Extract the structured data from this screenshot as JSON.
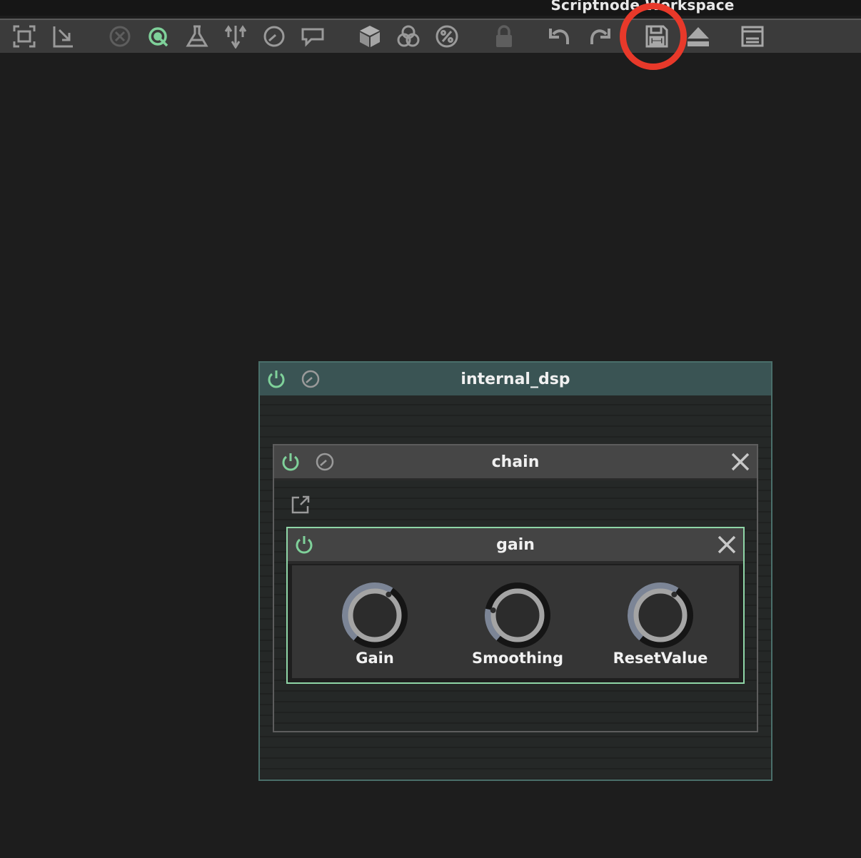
{
  "window": {
    "title": "Scriptnode Workspace"
  },
  "toolbar": {
    "buttons": [
      {
        "id": "zoom-fit",
        "icon": "zoom-fit-icon"
      },
      {
        "id": "fold",
        "icon": "fold-icon"
      },
      {
        "id": "cancel",
        "icon": "cancel-circle-icon"
      },
      {
        "id": "target",
        "icon": "target-icon",
        "active_color": "#7fd19a"
      },
      {
        "id": "flask",
        "icon": "flask-icon"
      },
      {
        "id": "split",
        "icon": "split-arrows-icon"
      },
      {
        "id": "cpu",
        "icon": "gauge-icon"
      },
      {
        "id": "comment",
        "icon": "speech-bubble-icon"
      },
      {
        "id": "box",
        "icon": "cube-icon"
      },
      {
        "id": "colors",
        "icon": "color-circles-icon"
      },
      {
        "id": "percent",
        "icon": "percent-icon"
      },
      {
        "id": "lock",
        "icon": "lock-icon"
      },
      {
        "id": "undo",
        "icon": "undo-icon"
      },
      {
        "id": "redo",
        "icon": "redo-icon"
      },
      {
        "id": "save",
        "icon": "floppy-disk-icon"
      },
      {
        "id": "eject",
        "icon": "eject-icon"
      },
      {
        "id": "list",
        "icon": "list-panel-icon"
      }
    ],
    "highlighted": "save"
  },
  "colors": {
    "accent_green": "#7fd19a",
    "highlight_red": "#e8392a",
    "dsp_header": "#3a5454",
    "gain_border": "#8fd6a7"
  },
  "nodes": {
    "internal_dsp": {
      "title": "internal_dsp"
    },
    "chain": {
      "title": "chain"
    },
    "gain": {
      "title": "gain",
      "parameters": [
        {
          "label": "Gain",
          "value_fraction": 0.62
        },
        {
          "label": "Smoothing",
          "value_fraction": 0.22
        },
        {
          "label": "ResetValue",
          "value_fraction": 0.62
        }
      ]
    }
  }
}
